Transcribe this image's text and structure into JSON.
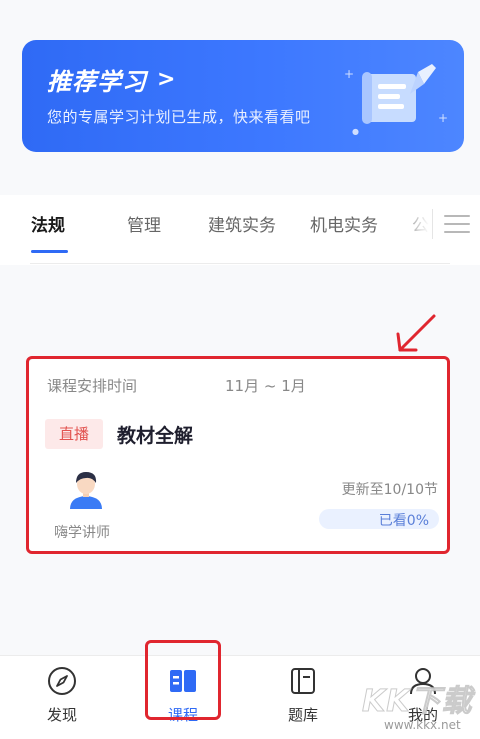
{
  "banner": {
    "title": "推荐学习",
    "chevron": ">",
    "subtitle": "您的专属学习计划已生成，快来看看吧",
    "background_color": "#3a74fb",
    "illustration_icon": "scroll-quill-icon"
  },
  "tabs": {
    "items": [
      {
        "label": "法规",
        "active": true
      },
      {
        "label": "管理",
        "active": false
      },
      {
        "label": "建筑实务",
        "active": false
      },
      {
        "label": "机电实务",
        "active": false
      },
      {
        "label": "公",
        "active": false
      }
    ],
    "menu_icon": "menu-lines-icon",
    "active_color": "#2f6af5"
  },
  "course_card": {
    "schedule_label": "课程安排时间",
    "schedule_value": "11月 ~ 1月",
    "badge": "直播",
    "title": "教材全解",
    "teacher": "嗨学讲师",
    "update_text": "更新至10/10节",
    "progress_label": "已看0%",
    "progress_percent": 0,
    "badge_color": "#e2524f"
  },
  "bottom_nav": {
    "items": [
      {
        "label": "发现",
        "icon": "compass-icon",
        "active": false
      },
      {
        "label": "课程",
        "icon": "book-icon",
        "active": true
      },
      {
        "label": "题库",
        "icon": "question-bank-icon",
        "active": false
      },
      {
        "label": "我的",
        "icon": "user-icon",
        "active": false
      }
    ]
  },
  "annotation_color": "#e0262f",
  "watermark": {
    "logo": "KK下载",
    "url": "www.kkx.net"
  }
}
